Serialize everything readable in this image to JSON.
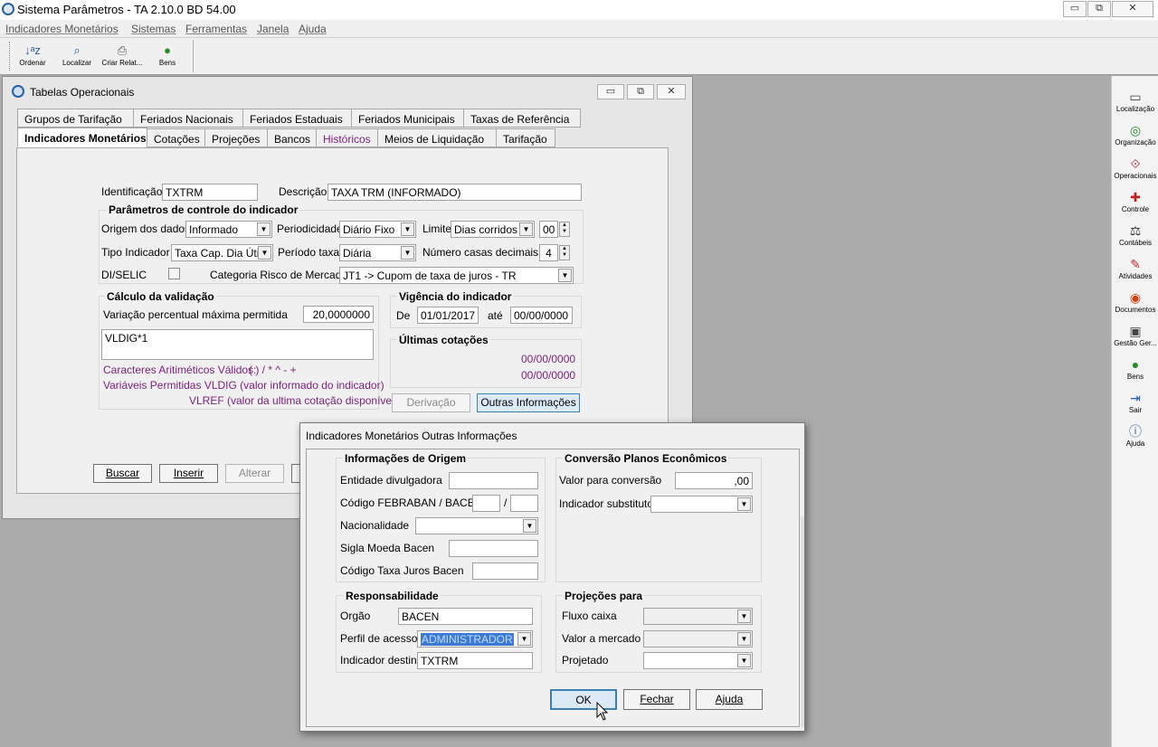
{
  "app": {
    "title": "Sistema Parâmetros -  TA 2.10.0 BD 54.00"
  },
  "window_controls": {
    "minimize": "▭",
    "restore": "⧉",
    "close": "✕"
  },
  "menu": [
    "Indicadores Monetários",
    "Sistemas",
    "Ferramentas",
    "Janela",
    "Ajuda"
  ],
  "toolbar": [
    {
      "label": "Ordenar",
      "icon": "sort-icon"
    },
    {
      "label": "Localizar",
      "icon": "find-icon"
    },
    {
      "label": "Criar Relat...",
      "icon": "printer-icon"
    },
    {
      "label": "Bens",
      "icon": "moneybag-icon"
    }
  ],
  "sidebar": [
    {
      "label": "Localização",
      "icon": "locate-icon"
    },
    {
      "label": "Organização",
      "icon": "organization-icon"
    },
    {
      "label": "Operacionais",
      "icon": "operations-icon"
    },
    {
      "label": "Controle",
      "icon": "control-icon"
    },
    {
      "label": "Contábeis",
      "icon": "scale-icon"
    },
    {
      "label": "Atividades",
      "icon": "activities-icon"
    },
    {
      "label": "Documentos",
      "icon": "documents-icon"
    },
    {
      "label": "Gestão Ger...",
      "icon": "management-icon"
    },
    {
      "label": "Bens",
      "icon": "moneybag-icon"
    },
    {
      "label": "Sair",
      "icon": "exit-icon"
    },
    {
      "label": "Ajuda",
      "icon": "help-icon"
    }
  ],
  "tabelas": {
    "title": "Tabelas Operacionais",
    "tabs_row1": [
      "Grupos de Tarifação",
      "Feriados Nacionais",
      "Feriados Estaduais",
      "Feriados Municipais",
      "Taxas de Referência"
    ],
    "tabs_row2": [
      "Indicadores Monetários",
      "Cotações",
      "Projeções",
      "Bancos",
      "Históricos",
      "Meios de Liquidação",
      "Tarifação"
    ],
    "identificacao_label": "Identificação",
    "identificacao": "TXTRM",
    "descricao_label": "Descrição",
    "descricao": "TAXA TRM (INFORMADO)",
    "parametros_title": "Parâmetros de controle do indicador",
    "origem_label": "Origem dos dados",
    "origem": "Informado",
    "periodicidade_label": "Periodicidade",
    "periodicidade": "Diário Fixo",
    "limite_label": "Limite",
    "limite": "Dias corridos",
    "limite_num": "00",
    "tipo_label": "Tipo Indicador",
    "tipo": "Taxa Cap. Dia Útil",
    "periodo_label": "Período taxa",
    "periodo": "Diária",
    "casas_label": "Número casas decimais",
    "casas": "4",
    "diselic_label": "DI/SELIC",
    "categoria_label": "Categoria Risco de Mercado",
    "categoria": "JT1 -> Cupom de taxa de juros - TR",
    "calculo_title": "Cálculo da validação",
    "variacao_label": "Variação percentual máxima permitida",
    "variacao": "20,0000000",
    "formula": "VLDIG*1",
    "caracteres": "Caracteres Aritiméticos Válidos:",
    "caracteres_val": "( ) / * ^ - +",
    "variaveis": "Variáveis Permitidas VLDIG  (valor informado do indicador)",
    "vlref": "VLREF (valor da ultima cotação disponível)",
    "vigencia_title": "Vigência do indicador",
    "de_label": "De",
    "de": "01/01/2017",
    "ate_label": "até",
    "ate": "00/00/0000",
    "ultimas_title": "Últimas cotações",
    "cot1": "00/00/0000",
    "cot2": "00/00/0000",
    "derivacao": "Derivação",
    "outras": "Outras Informações",
    "buscar": "Buscar",
    "inserir": "Inserir",
    "alterar": "Alterar"
  },
  "dialog": {
    "title": "Indicadores Monetários Outras Informações",
    "origem_title": "Informações de Origem",
    "entidade_label": "Entidade divulgadora",
    "entidade": "",
    "febraban_label": "Código FEBRABAN / BACEN",
    "slash": "/",
    "nacionalidade_label": "Nacionalidade",
    "sigla_label": "Sigla Moeda Bacen",
    "codtaxa_label": "Código Taxa Juros Bacen",
    "conversao_title": "Conversão Planos Econômicos",
    "valorconv_label": "Valor para conversão",
    "valorconv": ",00",
    "substituto_label": "Indicador substituto",
    "resp_title": "Responsabilidade",
    "orgao_label": "Orgão",
    "orgao": "BACEN",
    "perfil_label": "Perfil de acesso",
    "perfil": "ADMINISTRADOR",
    "destino_label": "Indicador destino",
    "destino": "TXTRM",
    "proj_title": "Projeções para",
    "fluxo_label": "Fluxo caixa",
    "valormerc_label": "Valor a mercado",
    "projetado_label": "Projetado",
    "ok": "OK",
    "fechar": "Fechar",
    "ajuda": "Ajuda"
  }
}
